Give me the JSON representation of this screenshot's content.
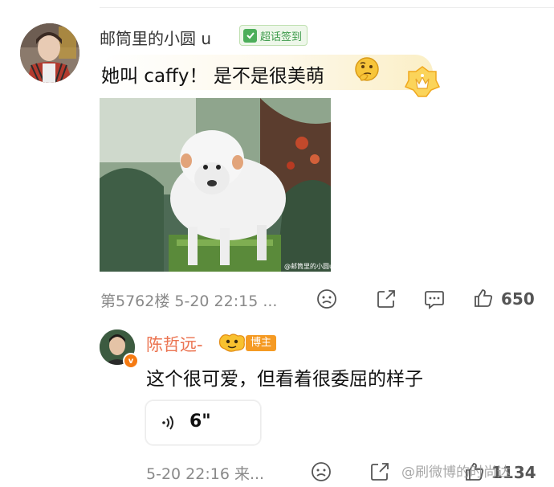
{
  "post": {
    "username": "邮筒里的小圆 u",
    "badge_label": "超话签到",
    "comment_text": "她叫 caffy！ 是不是很美萌",
    "image_watermark": "@邮筒里的小圆u",
    "floor_time": "第5762楼 5-20 22:15 ...",
    "like_count": "650"
  },
  "reply": {
    "username": "陈哲远-",
    "badge_label": "博主",
    "verified_mark": "v",
    "comment_text": "这个很可爱，但看着很委屈的样子",
    "voice_duration": "6\"",
    "time_meta": "5-20 22:16 来...",
    "like_count": "1134"
  },
  "watermark": "@刷微博的时尚达",
  "colors": {
    "reply_name": "#eb7350",
    "badge_green": "#3e9b4c",
    "blogger_orange": "#f59a23"
  },
  "icons": [
    "check-icon",
    "thinking-emoji-icon",
    "crown-badge-icon",
    "dislike-face-icon",
    "share-icon",
    "comment-icon",
    "like-thumb-icon",
    "voice-icon"
  ]
}
